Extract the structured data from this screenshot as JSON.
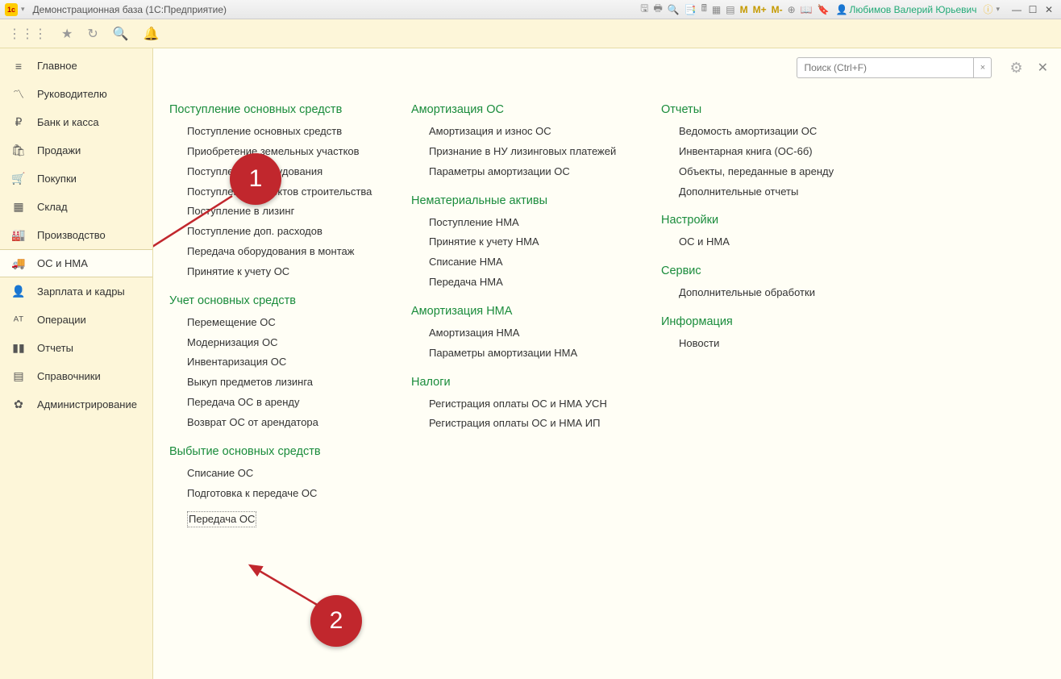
{
  "window": {
    "title": "Демонстрационная база  (1С:Предприятие)",
    "user": "Любимов Валерий Юрьевич"
  },
  "toolbar_m": {
    "m": "M",
    "mplus": "M+",
    "mminus": "M-"
  },
  "sidebar": {
    "items": [
      {
        "icon": "≡",
        "label": "Главное"
      },
      {
        "icon": "〽",
        "label": "Руководителю"
      },
      {
        "icon": "₽",
        "label": "Банк и касса"
      },
      {
        "icon": "🛍",
        "label": "Продажи"
      },
      {
        "icon": "🛒",
        "label": "Покупки"
      },
      {
        "icon": "▦",
        "label": "Склад"
      },
      {
        "icon": "🏭",
        "label": "Производство"
      },
      {
        "icon": "🚚",
        "label": "ОС и НМА"
      },
      {
        "icon": "👤",
        "label": "Зарплата и кадры"
      },
      {
        "icon": "ᴬᵀ",
        "label": "Операции"
      },
      {
        "icon": "▮▮",
        "label": "Отчеты"
      },
      {
        "icon": "▤",
        "label": "Справочники"
      },
      {
        "icon": "✿",
        "label": "Администрирование"
      }
    ],
    "active_index": 7
  },
  "search": {
    "placeholder": "Поиск (Ctrl+F)"
  },
  "content": {
    "col1": [
      {
        "title": "Поступление основных средств",
        "links": [
          "Поступление основных средств",
          "Приобретение земельных участков",
          "Поступление оборудования",
          "Поступление объектов строительства",
          "Поступление в лизинг",
          "Поступление доп. расходов",
          "Передача оборудования в монтаж",
          "Принятие к учету ОС"
        ]
      },
      {
        "title": "Учет основных средств",
        "links": [
          "Перемещение ОС",
          "Модернизация ОС",
          "Инвентаризация ОС",
          "Выкуп предметов лизинга",
          "Передача ОС в аренду",
          "Возврат ОС от арендатора"
        ]
      },
      {
        "title": "Выбытие основных средств",
        "links": [
          "Списание ОС",
          "Подготовка к передаче ОС",
          "Передача ОС"
        ],
        "selected_index": 2
      }
    ],
    "col2": [
      {
        "title": "Амортизация ОС",
        "links": [
          "Амортизация и износ ОС",
          "Признание в НУ лизинговых платежей",
          "Параметры амортизации ОС"
        ]
      },
      {
        "title": "Нематериальные активы",
        "links": [
          "Поступление НМА",
          "Принятие к учету НМА",
          "Списание НМА",
          "Передача НМА"
        ]
      },
      {
        "title": "Амортизация НМА",
        "links": [
          "Амортизация НМА",
          "Параметры амортизации НМА"
        ]
      },
      {
        "title": "Налоги",
        "links": [
          "Регистрация оплаты ОС и НМА УСН",
          "Регистрация оплаты ОС и НМА ИП"
        ]
      }
    ],
    "col3": [
      {
        "title": "Отчеты",
        "links": [
          "Ведомость амортизации ОС",
          "Инвентарная книга (ОС-6б)",
          "Объекты, переданные в аренду",
          "Дополнительные отчеты"
        ]
      },
      {
        "title": "Настройки",
        "links": [
          "ОС и НМА"
        ]
      },
      {
        "title": "Сервис",
        "links": [
          "Дополнительные обработки"
        ]
      },
      {
        "title": "Информация",
        "links": [
          "Новости"
        ]
      }
    ]
  },
  "annotations": {
    "badge1": "1",
    "badge2": "2"
  }
}
